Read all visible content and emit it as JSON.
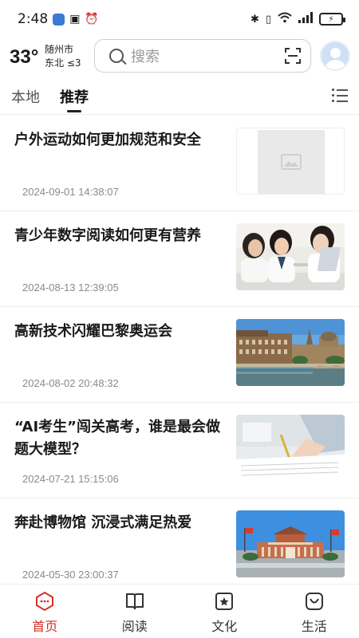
{
  "status_bar": {
    "time": "2:48",
    "icons": [
      "app-badge-icon",
      "nfc-icon",
      "alarm-icon",
      "bluetooth-icon",
      "vibrate-icon",
      "wifi-icon",
      "signal-icon",
      "battery-icon"
    ]
  },
  "header": {
    "temperature": "33°",
    "city": "随州市",
    "wind": "东北 ≤3",
    "search_placeholder": "搜索"
  },
  "tabs": [
    {
      "label": "本地"
    },
    {
      "label": "推荐"
    }
  ],
  "news": [
    {
      "title": "户外运动如何更加规范和安全",
      "date": "2024-09-01 14:38:07",
      "thumbnail": "image-placeholder"
    },
    {
      "title": "青少年数字阅读如何更有营养",
      "date": "2024-08-13 12:39:05",
      "thumbnail": "students-reading"
    },
    {
      "title": "高新技术闪耀巴黎奥运会",
      "date": "2024-08-02 20:48:32",
      "thumbnail": "paris-river"
    },
    {
      "title": "“AI考生”闯关高考，谁是最会做题大模型？",
      "date": "2024-07-21 15:15:06",
      "thumbnail": "exam-writing"
    },
    {
      "title": "奔赴博物馆 沉浸式满足热爱",
      "date": "2024-05-30 23:00:37",
      "thumbnail": "museum-building"
    }
  ],
  "bottom_nav": [
    {
      "label": "首页",
      "icon": "home-icon",
      "active": true
    },
    {
      "label": "阅读",
      "icon": "book-icon",
      "active": false
    },
    {
      "label": "文化",
      "icon": "culture-icon",
      "active": false
    },
    {
      "label": "生活",
      "icon": "life-icon",
      "active": false
    }
  ],
  "colors": {
    "accent": "#d6302a",
    "text": "#1a1a1a",
    "date": "#8a8a8a"
  }
}
